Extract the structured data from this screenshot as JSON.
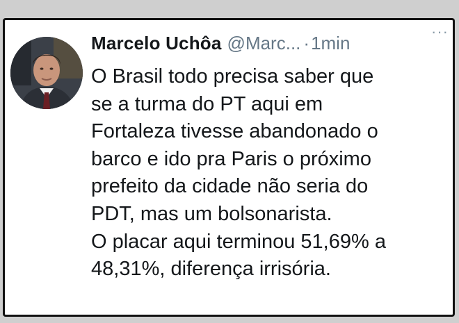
{
  "tweet": {
    "author_name": "Marcelo Uchôa",
    "handle": "@Marc...",
    "separator": "·",
    "time": "1min",
    "more": "···",
    "lines": [
      "O Brasil todo precisa saber que",
      "se a turma do PT aqui em",
      "Fortaleza tivesse abandonado o",
      "barco e ido pra Paris o próximo",
      "prefeito da cidade não seria do",
      "PDT, mas um bolsonarista.",
      "O placar aqui terminou 51,69% a",
      "48,31%, diferença irrisória."
    ]
  },
  "colors": {
    "text": "#14171a",
    "secondary": "#657786",
    "border": "#111111"
  },
  "icons": {
    "more": "more-options-icon",
    "avatar": "avatar"
  }
}
